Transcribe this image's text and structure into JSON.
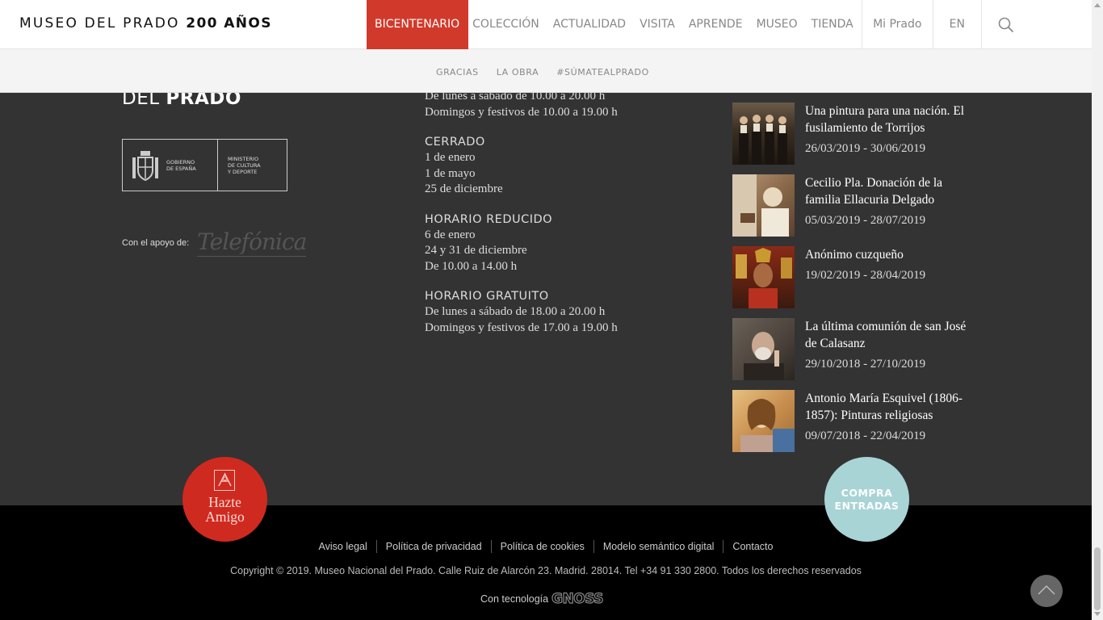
{
  "header": {
    "logo_regular": "MUSEO DEL PRADO",
    "logo_bold": "200 AÑOS",
    "nav": [
      {
        "label": "BICENTENARIO"
      },
      {
        "label": "COLECCIÓN"
      },
      {
        "label": "ACTUALIDAD"
      },
      {
        "label": "VISITA"
      },
      {
        "label": "APRENDE"
      },
      {
        "label": "MUSEO"
      },
      {
        "label": "TIENDA"
      }
    ],
    "mi_prado": "Mi Prado",
    "language": "EN",
    "search_icon": "search-icon",
    "accent": "#d13a2b"
  },
  "subnav": {
    "items": [
      "GRACIAS",
      "LA OBRA",
      "#SÚMATEALPRADO"
    ]
  },
  "brand": {
    "regular": "DEL",
    "bold": "PRADO"
  },
  "gov": {
    "left_text": [
      "GOBIERNO",
      "DE ESPAÑA"
    ],
    "right_text": [
      "MINISTERIO",
      "DE CULTURA",
      "Y DEPORTE"
    ]
  },
  "apoyo": {
    "label": "Con el apoyo de:",
    "sponsor": "Telefónica"
  },
  "hours": {
    "open_lines": [
      "De lunes a sábado de 10.00 a 20.00 h",
      "Domingos y festivos de 10.00 a 19.00 h"
    ],
    "sections": [
      {
        "title": "CERRADO",
        "lines": [
          "1 de enero",
          "1 de mayo",
          "25 de diciembre"
        ]
      },
      {
        "title": "HORARIO REDUCIDO",
        "lines": [
          "6 de enero",
          "24 y 31 de diciembre",
          "De 10.00 a 14.00 h"
        ]
      },
      {
        "title": "HORARIO GRATUITO",
        "lines": [
          "De lunes a sábado de 18.00 a 20.00 h",
          "Domingos y festivos de 17.00 a 19.00 h"
        ]
      }
    ]
  },
  "exhibitions": [
    {
      "title": "Una pintura para una nación. El fusilamiento de Torrijos",
      "dates": "26/03/2019 - 30/06/2019",
      "color": "#4a3a2a"
    },
    {
      "title": "Cecilio Pla. Donación de la familia Ellacuria Delgado",
      "dates": "05/03/2019 - 28/07/2019",
      "color": "#8a6a4a"
    },
    {
      "title": "Anónimo cuzqueño",
      "dates": "19/02/2019 - 28/04/2019",
      "color": "#7a3a20"
    },
    {
      "title": "La última comunión de san José de Calasanz",
      "dates": "29/10/2018 - 27/10/2019",
      "color": "#5a5048"
    },
    {
      "title": "Antonio María Esquivel (1806-1857): Pinturas religiosas",
      "dates": "09/07/2018 - 22/04/2019",
      "color": "#c08a4a"
    }
  ],
  "amigo": {
    "line1": "Hazte",
    "line2": "Amigo",
    "color": "#cf2a1f"
  },
  "compra": {
    "line1": "COMPRA",
    "line2": "ENTRADAS",
    "color": "#a9d4d6"
  },
  "footer": {
    "links": [
      "Aviso legal",
      "Política de privacidad",
      "Política de cookies",
      "Modelo semántico digital",
      "Contacto"
    ],
    "copyright": "Copyright © 2019. Museo Nacional del Prado. Calle Ruiz de Alarcón 23. Madrid. 28014. Tel +34 91 330 2800. Todos los derechos reservados",
    "tech_label": "Con tecnología",
    "tech_brand": "GNOSS",
    "to_top_icon": "chevron-up-icon"
  }
}
